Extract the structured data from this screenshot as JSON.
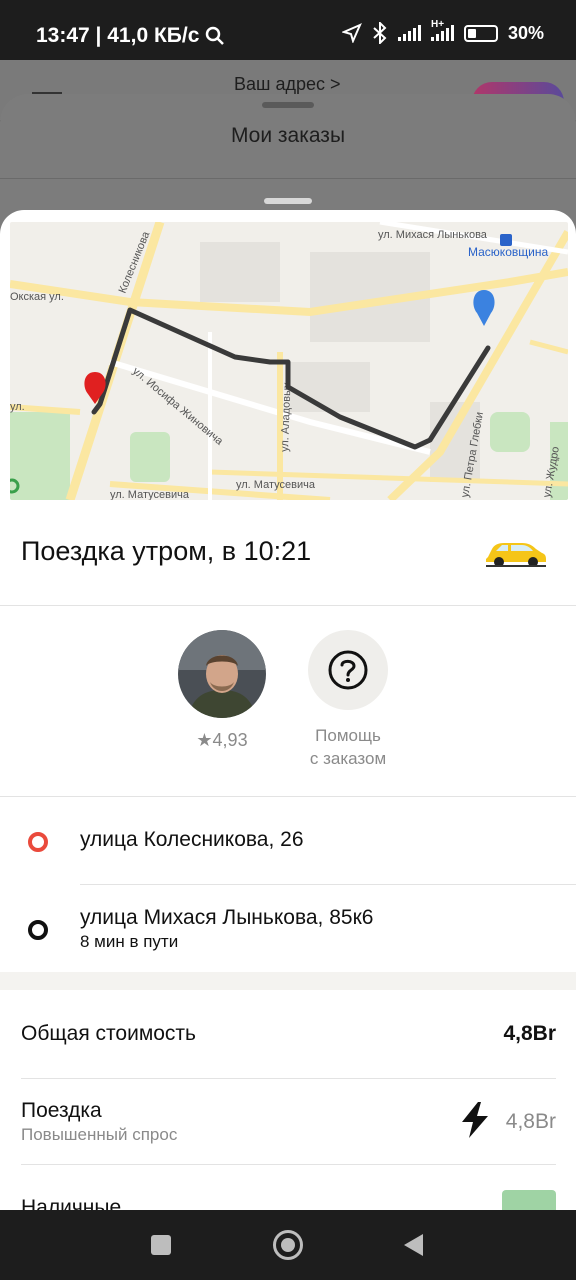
{
  "status_bar": {
    "time_speed": "13:47 | 41,0 КБ/с",
    "network_type": "H+",
    "battery": "30%"
  },
  "background": {
    "address_link": "Ваш адрес >"
  },
  "orders_sheet": {
    "title": "Мои заказы"
  },
  "map": {
    "streets": [
      "ул. Михася Лынькова",
      "Масюковщина",
      "Колесникова",
      "Окская ул.",
      "ул. Иосифа Жиновича",
      "ул. Аладовых",
      "ул. Матусевича",
      "ул. Петра Глебки",
      "ул. Жудро",
      "ул.",
      "ул. Матусевича"
    ],
    "colors": {
      "route": "#3a3a3a",
      "origin_pin": "#e02020",
      "destination_pin": "#3b82e0"
    }
  },
  "trip": {
    "title": "Поездка утром, в 10:21",
    "vehicle_icon": "taxi-car-icon"
  },
  "driver": {
    "rating": "★4,93"
  },
  "help": {
    "label_line1": "Помощь",
    "label_line2": "с заказом"
  },
  "route": {
    "origin": "улица Колесникова, 26",
    "destination": "улица Михася Лынькова, 85к6",
    "duration": "8 мин в пути"
  },
  "cost": {
    "total_label": "Общая стоимость",
    "total_value": "4,8Br",
    "ride_label": "Поездка",
    "ride_sub": "Повышенный спрос",
    "ride_value": "4,8Br",
    "payment_label": "Наличные"
  }
}
